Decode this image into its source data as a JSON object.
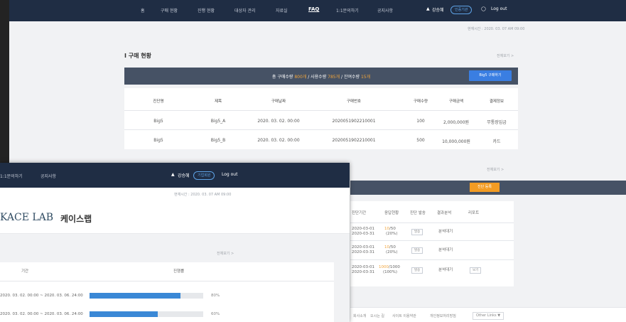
{
  "back_window": {
    "nav": {
      "items": [
        "홈",
        "구매 현황",
        "진행 현황",
        "대상자 관리",
        "자료실",
        "FAQ",
        "1:1문의하기",
        "공지사항"
      ],
      "active": "FAQ",
      "user_name": "강승혜",
      "badge": "인증기관",
      "logout": "Log out"
    },
    "timestamp": "현재시간 : 2020. 03. 07 AM 09:00",
    "purchase": {
      "title": "I 구매 현황",
      "more": "전체보기 >",
      "summary_prefix": "총 구매수량 ",
      "total": "800개",
      "summary_mid1": " / 사용수량 ",
      "used": "785개",
      "summary_mid2": " / 잔여수량 ",
      "remaining": "15개",
      "buy_button": "Big5 구매하기",
      "columns": [
        "진단명",
        "제목",
        "구매날짜",
        "구매번호",
        "구매수량",
        "구매금액",
        "결제정보"
      ],
      "rows": [
        [
          "Big5",
          "Big5_A",
          "2020. 03. 02. 00:00",
          "2020051902210001",
          "100",
          "2,000,000원",
          "무통장입금"
        ],
        [
          "Big5",
          "Big5_B",
          "2020. 03. 02. 00:00",
          "2020051902210001",
          "500",
          "10,000,000원",
          "카드"
        ]
      ]
    },
    "second": {
      "more": "전체보기 >",
      "button": "진단 등록",
      "columns": [
        "진단기간",
        "응답현황",
        "진단 발송",
        "결과분석",
        "리포트"
      ],
      "rows": [
        {
          "dates": [
            "2020-03-01",
            "2020-03-31"
          ],
          "count": "10",
          "total": "/50",
          "pct": "(20%)",
          "send": "발송",
          "analysis": "분석대기",
          "report": ""
        },
        {
          "dates": [
            "2020-03-01",
            "2020-03-31"
          ],
          "count": "10",
          "total": "/50",
          "pct": "(20%)",
          "send": "발송",
          "analysis": "분석대기",
          "report": ""
        },
        {
          "dates": [
            "2020-03-01",
            "2020-03-31"
          ],
          "count": "1000",
          "total": "/1000",
          "pct": "(100%)",
          "send": "발송",
          "analysis": "분석대기",
          "report": "보기"
        }
      ]
    },
    "footer": {
      "links": [
        "회사소개",
        "오시는 길",
        "사이트 이용약관",
        "개인정보처리방침"
      ],
      "other": "Other Links ▼"
    }
  },
  "front_window": {
    "nav": {
      "items": [
        "1:1문의하기",
        "공지사항"
      ],
      "user_name": "강승혜",
      "badge": "기업회원",
      "logout": "Log out"
    },
    "timestamp": "현재시간 : 2020. 03. 07 AM 09:00",
    "logo_en": "KACE LAB",
    "logo_ko": "케이스랩",
    "more": "전체보기 >",
    "columns": [
      "기간",
      "진행률"
    ],
    "rows": [
      {
        "period": "2020. 03. 02. 00:00 ~ 2020. 03. 06. 24:00",
        "progress": 0.8,
        "label": "80%"
      },
      {
        "period": "2020. 03. 02. 00:00 ~ 2020. 03. 06. 24:00",
        "progress": 0.6,
        "label": "60%"
      }
    ]
  },
  "colors": {
    "nav": "#1f2d44",
    "summary_bar": "#465265",
    "accent_blue": "#3a7ee2",
    "accent_orange": "#f39c23",
    "progress": "#3a88d6"
  }
}
